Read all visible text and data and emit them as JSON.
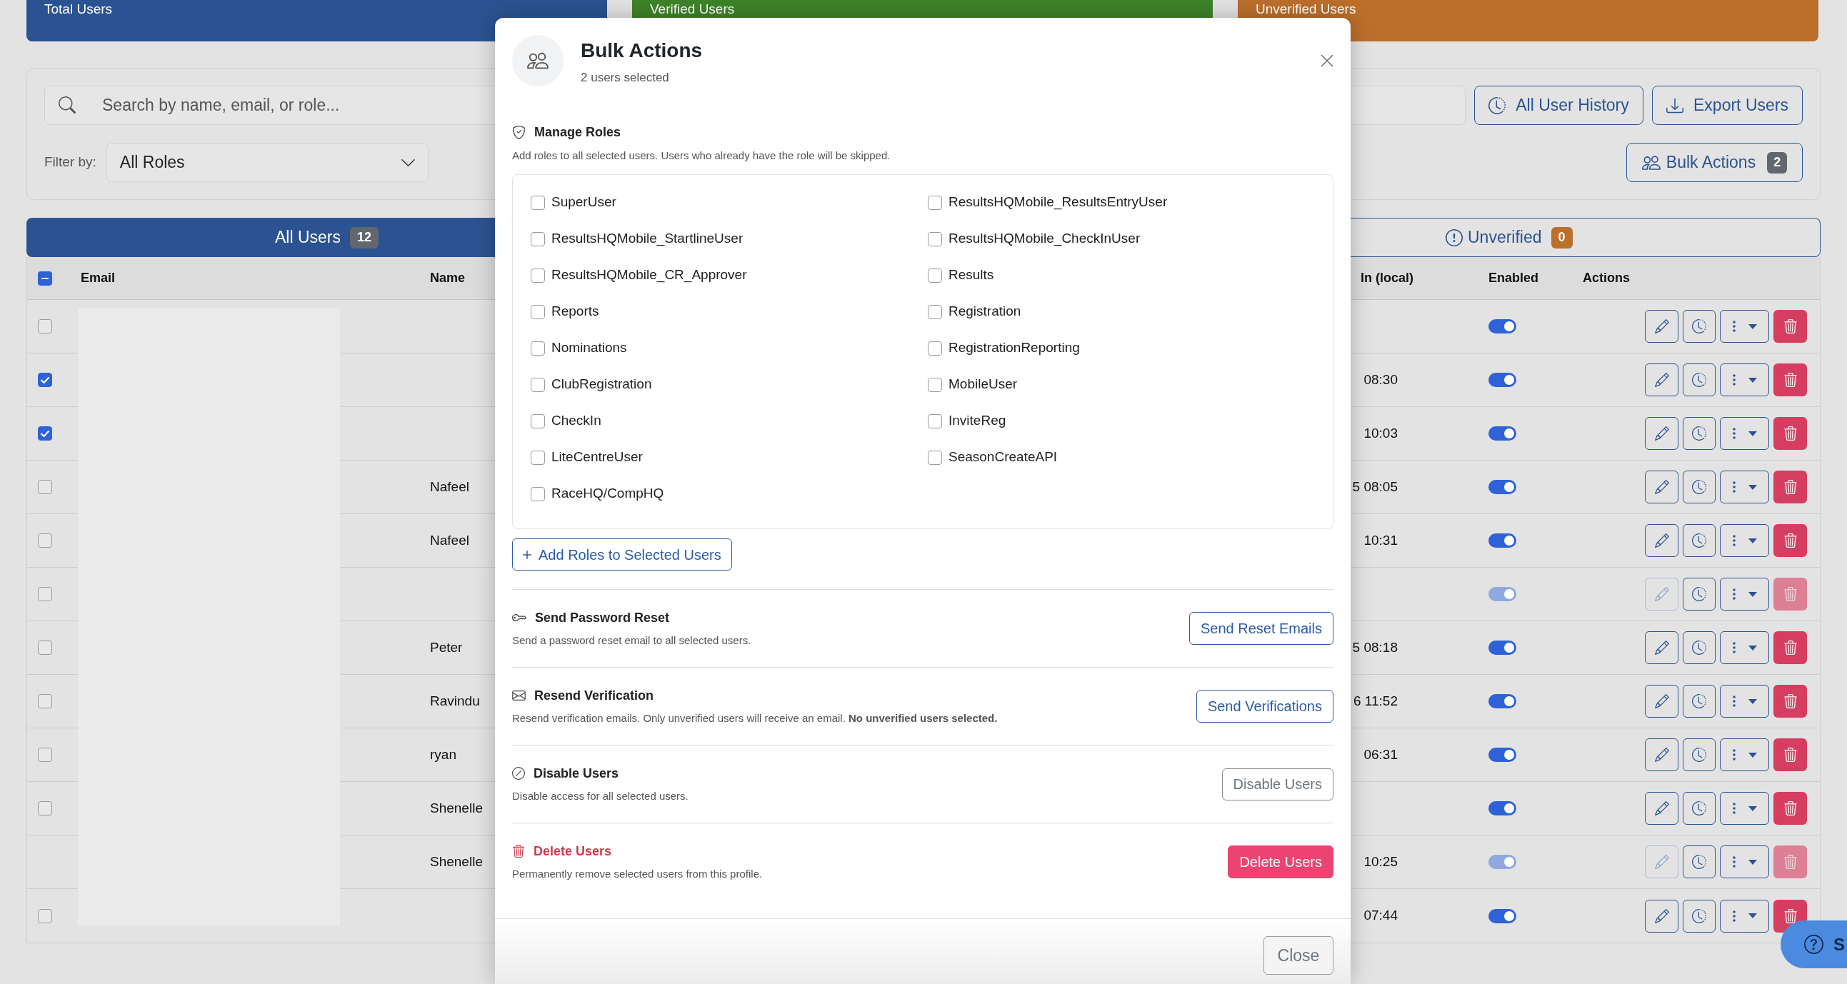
{
  "stat_cards": [
    {
      "label": "Total Users",
      "color": "#2b5391"
    },
    {
      "label": "Verified Users",
      "color": "#3e8329"
    },
    {
      "label": "Unverified Users",
      "color": "#bb6f2b"
    }
  ],
  "toolbar": {
    "search": {
      "placeholder": "Search by name, email, or role..."
    },
    "buttons": [
      {
        "kind": "history",
        "label": "All User History"
      },
      {
        "kind": "export",
        "label": "Export Users"
      }
    ],
    "filter": {
      "label": "Filter by:",
      "value": "All Roles"
    },
    "bulk_button": {
      "label": "Bulk Actions",
      "count": "2"
    }
  },
  "tabs": [
    {
      "kind": "all",
      "label": "All Users",
      "count": "12",
      "color": "#62676d",
      "selected": true
    },
    {
      "kind": "unverified",
      "label": "Unverified",
      "count": "0",
      "color": "#bb6f2b",
      "selected": false
    }
  ],
  "table": {
    "select_all": {
      "indeterminate": true
    },
    "columns": [
      "Email",
      "Name",
      "In (local)",
      "Enabled",
      "Actions"
    ],
    "rows": [
      {
        "checked": false,
        "enabled": true,
        "disabled": false
      },
      {
        "checked": true,
        "time": "08:30",
        "enabled": true,
        "disabled": false
      },
      {
        "checked": true,
        "time": "10:03",
        "enabled": true,
        "disabled": false
      },
      {
        "checked": false,
        "name": "Nafeel",
        "time": "5 08:05",
        "enabled": true,
        "disabled": false
      },
      {
        "checked": false,
        "name": "Nafeel",
        "time": "10:31",
        "enabled": true,
        "disabled": false
      },
      {
        "checked": false,
        "enabled": true,
        "disabled": true
      },
      {
        "checked": false,
        "name": "Peter",
        "time": "5 08:18",
        "enabled": true,
        "disabled": false
      },
      {
        "checked": false,
        "name": "Ravindu",
        "time": "6 11:52",
        "enabled": true,
        "disabled": false
      },
      {
        "checked": false,
        "name": "ryan",
        "time": "06:31",
        "enabled": true,
        "disabled": false
      },
      {
        "checked": false,
        "name": "Shenelle",
        "enabled": true,
        "disabled": false
      },
      {
        "name": "Shenelle",
        "time": "10:25",
        "enabled": true,
        "disabled": true
      },
      {
        "checked": false,
        "time": "07:44",
        "enabled": true,
        "disabled": false
      }
    ]
  },
  "modal": {
    "title": "Bulk Actions",
    "subtitle": "2 users selected",
    "roles_section": {
      "title": "Manage Roles",
      "description": "Add roles to all selected users. Users who already have the role will be skipped.",
      "roles": [
        {
          "label": "SuperUser",
          "checked": false
        },
        {
          "label": "ResultsHQMobile_ResultsEntryUser",
          "checked": false
        },
        {
          "label": "ResultsHQMobile_StartlineUser",
          "checked": false
        },
        {
          "label": "ResultsHQMobile_CheckInUser",
          "checked": false
        },
        {
          "label": "ResultsHQMobile_CR_Approver",
          "checked": false
        },
        {
          "label": "Results",
          "checked": false
        },
        {
          "label": "Reports",
          "checked": false
        },
        {
          "label": "Registration",
          "checked": false
        },
        {
          "label": "Nominations",
          "checked": false
        },
        {
          "label": "RegistrationReporting",
          "checked": false
        },
        {
          "label": "ClubRegistration",
          "checked": false
        },
        {
          "label": "MobileUser",
          "checked": false
        },
        {
          "label": "CheckIn",
          "checked": false
        },
        {
          "label": "InviteReg",
          "checked": false
        },
        {
          "label": "LiteCentreUser",
          "checked": false
        },
        {
          "label": "SeasonCreateAPI",
          "checked": false
        },
        {
          "label": "RaceHQ/CompHQ",
          "checked": false
        }
      ],
      "add_button": "Add Roles to Selected Users"
    },
    "actions": [
      {
        "kind": "reset",
        "title": "Send Password Reset",
        "description": "Send a password reset email to all selected users.",
        "button": "Send Reset Emails"
      },
      {
        "kind": "verify",
        "title": "Resend Verification",
        "description": "Resend verification emails. Only unverified users will receive an email. **No unverified users selected.**",
        "button": "Send Verifications"
      },
      {
        "kind": "disable",
        "title": "Disable Users",
        "description": "Disable access for all selected users.",
        "button": "Disable Users"
      },
      {
        "kind": "delete",
        "title": "Delete Users",
        "description": "Permanently remove selected users from this profile.",
        "button": "Delete Users"
      }
    ],
    "close_button": "Close"
  },
  "support_button": {
    "label": "S"
  }
}
